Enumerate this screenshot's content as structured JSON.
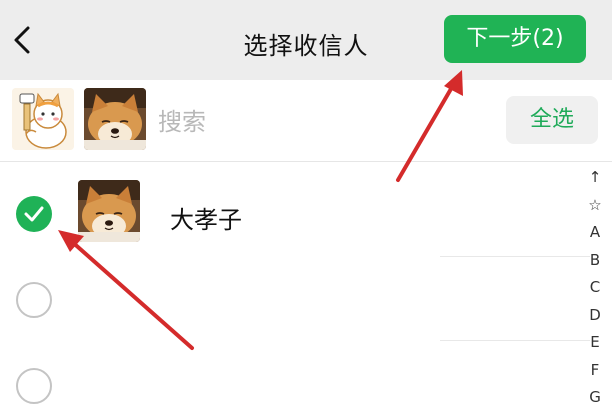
{
  "header": {
    "back_icon": "chevron-left-icon",
    "title": "选择收信人",
    "next_label": "下一步(2)"
  },
  "search": {
    "placeholder": "搜索",
    "select_all_label": "全选",
    "selected_avatars": [
      "cat-sticker",
      "shiba-dog"
    ]
  },
  "contacts": [
    {
      "name": "大孝子",
      "checked": true,
      "avatar": "shiba-dog"
    },
    {
      "name": "",
      "checked": false
    },
    {
      "name": "",
      "checked": false
    }
  ],
  "index_bar": [
    "↑",
    "☆",
    "A",
    "B",
    "C",
    "D",
    "E",
    "F",
    "G"
  ],
  "colors": {
    "accent_green": "#20b355",
    "header_bg": "#ededed",
    "annotation_red": "#d42b2b"
  }
}
